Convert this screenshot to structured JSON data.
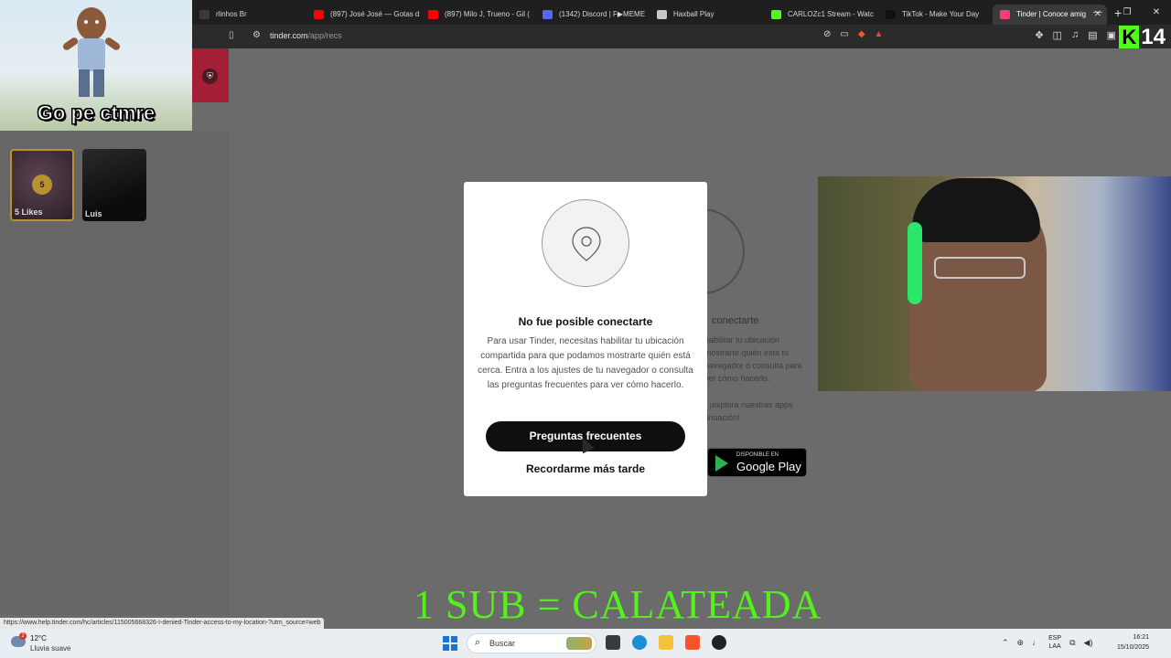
{
  "browser": {
    "tabs": [
      {
        "label": "rlinhos Br",
        "icon_color": "#3a3a3a"
      },
      {
        "label": "(897) José José — Gotas d",
        "icon_color": "#ff0000"
      },
      {
        "label": "(897) Milo J, Trueno - Gil (",
        "icon_color": "#ff0000"
      },
      {
        "label": "(1342) Discord | F▶MEME",
        "icon_color": "#5865f2"
      },
      {
        "label": "Haxball Play",
        "icon_color": "#c8c8c8"
      },
      {
        "label": "CARLOZc1 Stream - Watc",
        "icon_color": "#53fc18"
      },
      {
        "label": "TikTok - Make Your Day",
        "icon_color": "#111111"
      },
      {
        "label": "Tinder | Conoce amig",
        "icon_color": "#fe3c72",
        "active": true
      }
    ],
    "new_tab": "+",
    "window_controls": {
      "minimize": "—",
      "maximize": "❐",
      "close": "✕"
    },
    "address": {
      "host": "tinder.com",
      "path": "/app/recs"
    },
    "kick_badge": {
      "letter": "K",
      "number": "14"
    }
  },
  "overlay": {
    "meme_caption": "Go pe ctmre",
    "bottom_caption": "1 SUB = CALATEADA"
  },
  "sidebar": {
    "likes_card": {
      "count": "5",
      "label": "5 Likes"
    },
    "match_card": {
      "name": "Luis"
    }
  },
  "background_modal": {
    "title_fragment": "conectarte",
    "text_fragment": "habilitar tu ubicación mostrarte quién esta tu navegador o consulta para ver cómo hacerlo.",
    "text_fragment2": ", ¡explora nuestras apps tinuación!",
    "gplay_small": "DISPONIBLE EN",
    "gplay_big": "Google Play"
  },
  "modal": {
    "title": "No fue posible conectarte",
    "body": "Para usar Tinder, necesitas habilitar tu ubicación compartida para que podamos mostrarte quién está cerca. Entra a los ajustes de tu navegador o consulta las preguntas frecuentes para ver cómo hacerlo.",
    "primary_button": "Preguntas frecuentes",
    "secondary_button": "Recordarme más tarde"
  },
  "status_url": "https://www.help.tinder.com/hc/articles/115005668326-I-denied-Tinder-access-to-my-location-?utm_source=web",
  "taskbar": {
    "weather": {
      "temp": "12°C",
      "condition": "Lluvia suave",
      "badge": "2"
    },
    "search_placeholder": "Buscar",
    "lang": {
      "top": "ESP",
      "bottom": "LAA"
    },
    "time": "16:21",
    "date": "15/10/2025"
  },
  "colors": {
    "tinder_red": "#fe3c72",
    "kick_green": "#53fc18",
    "caption_green": "#53f31a",
    "gold": "#b8922f"
  }
}
